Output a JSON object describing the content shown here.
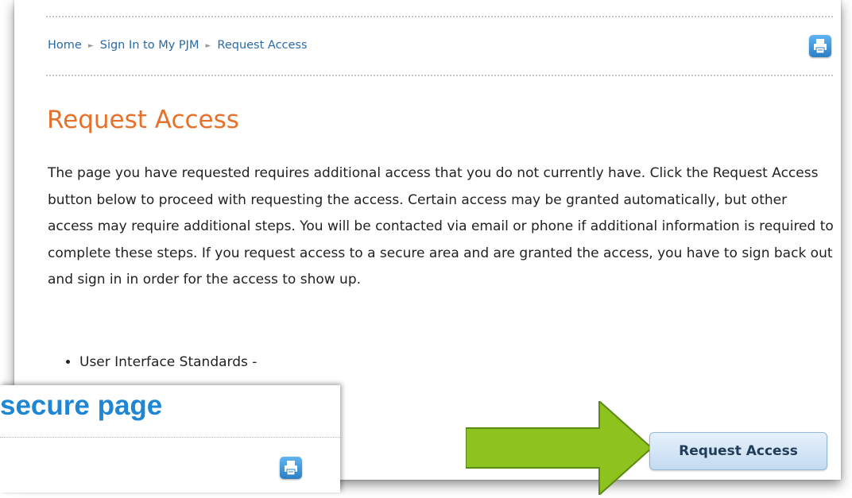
{
  "breadcrumb": {
    "items": [
      "Home",
      "Sign In to My PJM",
      "Request Access"
    ],
    "separator": "►"
  },
  "page": {
    "title": "Request Access",
    "body": "The page you have requested requires additional access that you do not currently have. Click the Request Access button below to proceed with requesting the access. Certain access may be granted automatically, but other access may require additional steps. You will be contacted via email or phone if additional information is required to complete these steps. If you request access to a secure area and are granted the access, you have to sign back out and sign in in order for the access to show up.",
    "bullets": [
      "User Interface Standards -"
    ]
  },
  "overlay": {
    "title": "secure page"
  },
  "button": {
    "request_label": "Request Access"
  },
  "icons": {
    "print": "print-icon",
    "arrow": "arrow-right-icon"
  },
  "colors": {
    "title": "#e7712b",
    "link": "#2a6aa6",
    "overlay_title": "#1f86d4",
    "arrow": "#8dc21f",
    "print_icon": "#3b8fd6",
    "button_bg": "#c3dbf0"
  }
}
